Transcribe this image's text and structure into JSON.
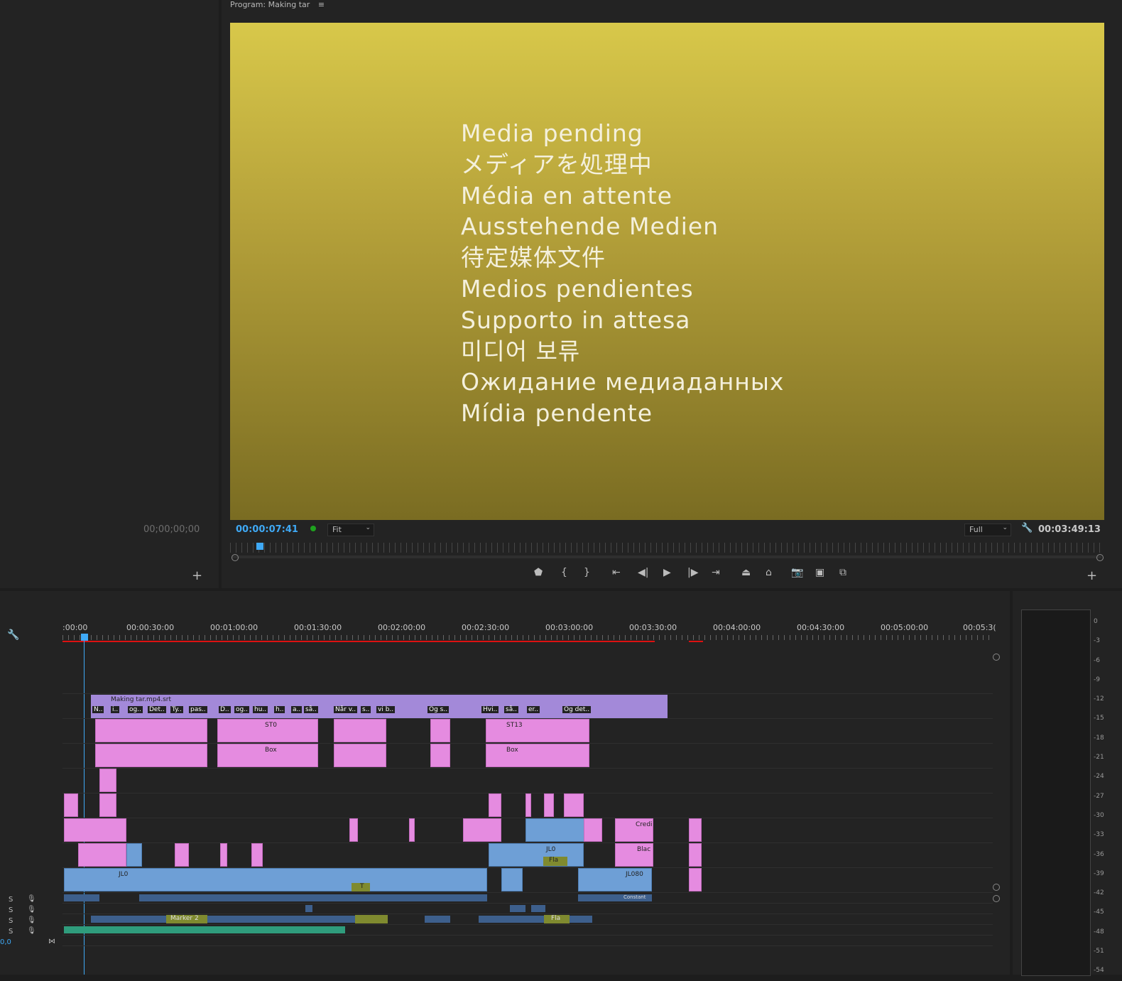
{
  "source_monitor": {
    "timecode": "00;00;00;00",
    "add_label": "+"
  },
  "program_monitor": {
    "title": "Program: Making tar",
    "menu_glyph": "≡",
    "pending_lines": [
      "Media pending",
      "メディアを処理中",
      "Média en attente",
      "Ausstehende Medien",
      "待定媒体文件",
      "Medios pendientes",
      "Supporto in attesa",
      "미디어 보류",
      "Ожидание медиаданных",
      "Mídia pendente"
    ],
    "current_timecode": "00:00:07:41",
    "zoom": "Fit",
    "resolution": "Full",
    "duration": "00:03:49:13",
    "add_label": "+",
    "colors": {
      "top": "#d8c84a",
      "bottom": "#7a6c22",
      "timecode_blue": "#3fa9f5"
    }
  },
  "timeline": {
    "ruler_labels": [
      ":00:00",
      "00:00:30:00",
      "00:01:00:00",
      "00:01:30:00",
      "00:02:00:00",
      "00:02:30:00",
      "00:03:00:00",
      "00:03:30:00",
      "00:04:00:00",
      "00:04:30:00",
      "00:05:00:00",
      "00:05:3("
    ],
    "caption_clip": "Making tar.mp4.srt",
    "caption_cues": [
      "N..",
      "i..",
      "og..",
      "Det..",
      "Ty..",
      "pas..",
      "D..",
      "og..",
      "hu..",
      "h..",
      "a..",
      "så..",
      "Når v..",
      "s..",
      "vi b..",
      "Og s..",
      "Hvi..",
      "så..",
      "er..",
      "Og det.."
    ],
    "clip_labels": {
      "st0": "ST0",
      "box": "Box",
      "st13": "ST13",
      "box2": "Box",
      "credi": "Credi",
      "blac": "Blac",
      "jl0": "JL0",
      "jl0a": "JL0",
      "fla": "Fla",
      "jl080": "JL080",
      "marker2": "Marker 2",
      "fla2": "Fla",
      "t": "T",
      "constant": "Constant"
    },
    "audio_track_labels": [
      "S",
      "S",
      "S",
      "S"
    ],
    "zero_label": "0,0",
    "fx": "fx"
  },
  "audio_meter": {
    "scale": [
      "0",
      "-3",
      "-6",
      "-9",
      "-12",
      "-15",
      "-18",
      "-21",
      "-24",
      "-27",
      "-30",
      "-33",
      "-36",
      "-39",
      "-42",
      "-45",
      "-48",
      "-51",
      "-54"
    ]
  }
}
